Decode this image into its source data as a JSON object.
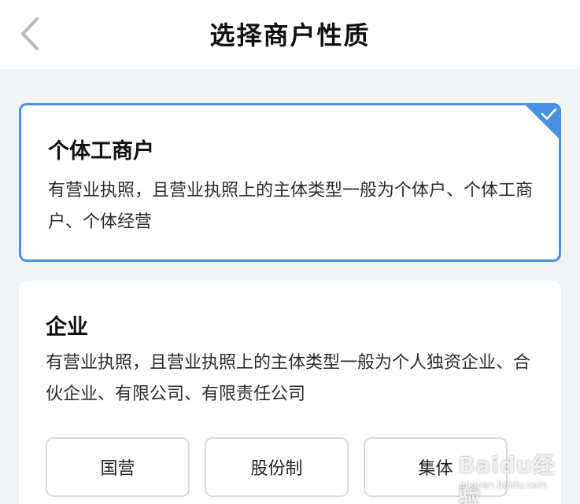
{
  "header": {
    "title": "选择商户性质"
  },
  "options": [
    {
      "title": "个体工商户",
      "description": "有营业执照，且营业执照上的主体类型一般为个体户、个体工商户、个体经营",
      "selected": true
    },
    {
      "title": "企业",
      "description": "有营业执照，且营业执照上的主体类型一般为个人独资企业、合伙企业、有限公司、有限责任公司",
      "selected": false,
      "sub_options": [
        "国营",
        "股份制",
        "集体"
      ]
    }
  ],
  "watermark": {
    "text": "Baidu经验",
    "url_text": "jingyan.baidu.com"
  },
  "colors": {
    "accent": "#4a90e2",
    "background": "#f2f3f5"
  }
}
